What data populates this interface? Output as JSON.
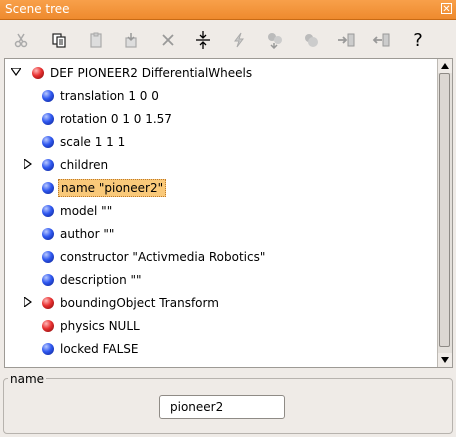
{
  "window": {
    "title": "Scene tree"
  },
  "toolbar": {
    "buttons": [
      {
        "icon": "cut-icon",
        "enabled": false
      },
      {
        "icon": "copy-icon",
        "enabled": true
      },
      {
        "icon": "paste-icon",
        "enabled": false
      },
      {
        "icon": "insert-after-icon",
        "enabled": false
      },
      {
        "icon": "delete-icon",
        "enabled": false
      },
      {
        "icon": "collapse-icon",
        "enabled": true
      },
      {
        "icon": "reset-icon",
        "enabled": false
      },
      {
        "icon": "transform-icon",
        "enabled": false
      },
      {
        "icon": "export-icon",
        "enabled": false
      },
      {
        "icon": "import-icon",
        "enabled": false
      },
      {
        "icon": "import2-icon",
        "enabled": false
      },
      {
        "icon": "help-icon",
        "enabled": true
      }
    ],
    "help_label": "?"
  },
  "tree": {
    "root": {
      "label": "DEF PIONEER2 DifferentialWheels",
      "color": "#e02020"
    },
    "rows": [
      {
        "label": "translation 1 0 0",
        "ball": "blue"
      },
      {
        "label": "rotation 0 1 0 1.57",
        "ball": "blue"
      },
      {
        "label": "scale 1 1 1",
        "ball": "blue"
      },
      {
        "label": "children",
        "ball": "blue",
        "expandable": true
      },
      {
        "label": "name \"pioneer2\"",
        "ball": "blue",
        "selected": true
      },
      {
        "label": "model \"\"",
        "ball": "blue"
      },
      {
        "label": "author \"\"",
        "ball": "blue"
      },
      {
        "label": "constructor \"Activmedia Robotics\"",
        "ball": "blue"
      },
      {
        "label": "description \"\"",
        "ball": "blue"
      },
      {
        "label": "boundingObject Transform",
        "ball": "red",
        "expandable": true
      },
      {
        "label": "physics NULL",
        "ball": "red"
      },
      {
        "label": "locked FALSE",
        "ball": "blue"
      }
    ]
  },
  "field_editor": {
    "group_title": "name",
    "value": "pioneer2"
  },
  "colors": {
    "titlebar": "#f29137",
    "selection": "#f9c97a"
  }
}
